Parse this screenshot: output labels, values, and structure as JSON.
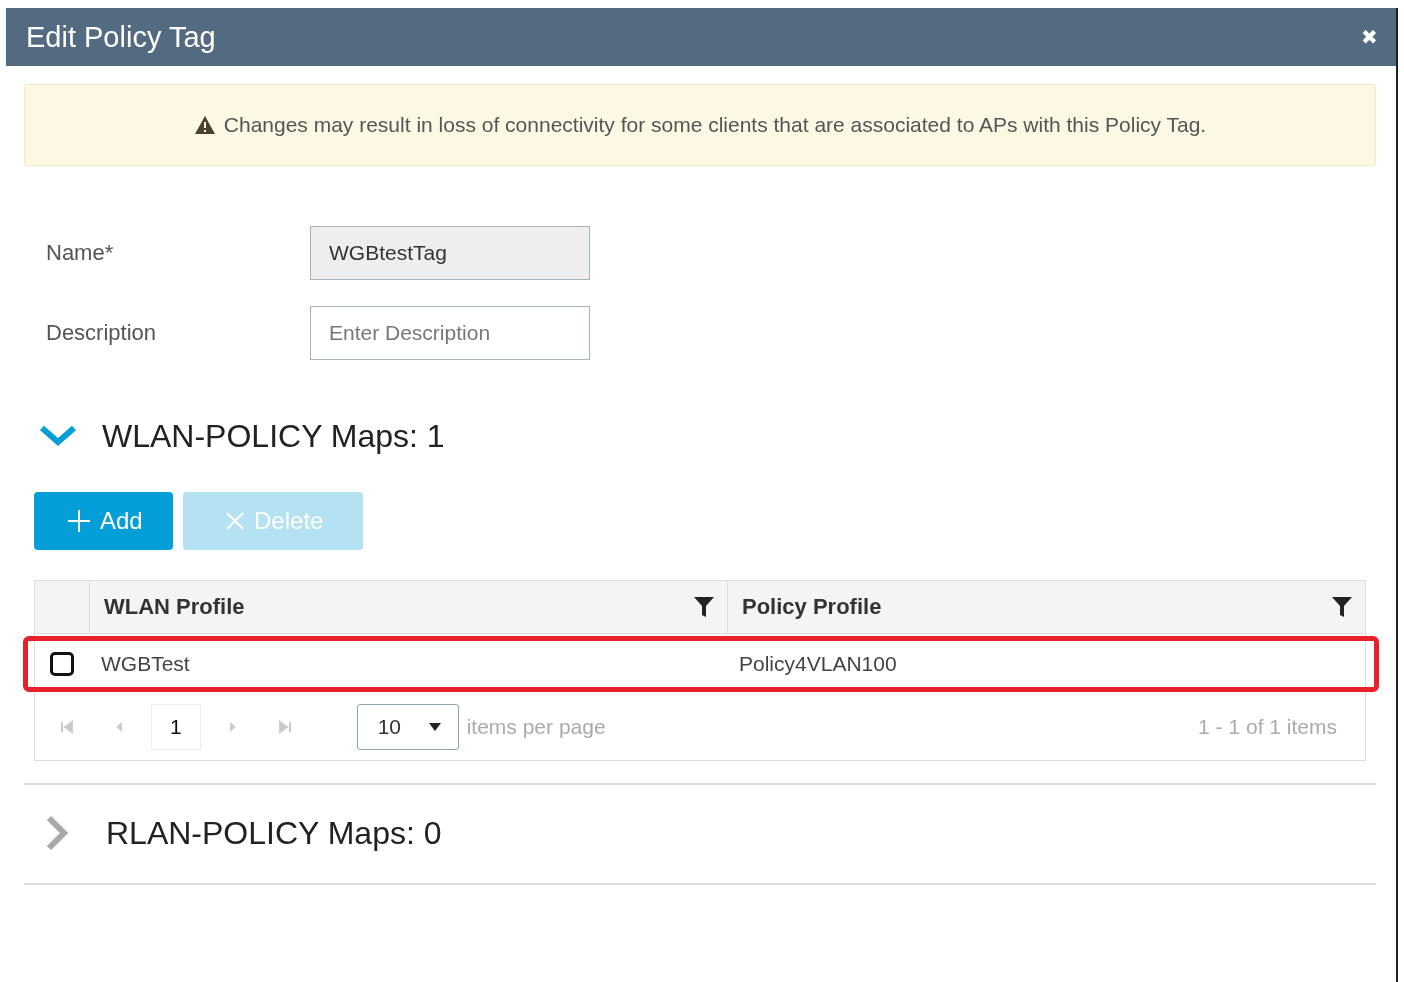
{
  "dialog": {
    "title": "Edit Policy Tag",
    "close": "✖"
  },
  "warning": {
    "text": "Changes may result in loss of connectivity for some clients that are associated to APs with this Policy Tag."
  },
  "fields": [
    {
      "label": "Name*",
      "value": "WGBtestTag",
      "disabled": true
    },
    {
      "label": "Description",
      "placeholder": "Enter Description",
      "disabled": false
    }
  ],
  "sections": [
    {
      "title": "WLAN-POLICY Maps: 1",
      "expanded": true,
      "buttons": [
        {
          "label": "Add",
          "kind": "add",
          "disabled": false
        },
        {
          "label": "Delete",
          "kind": "delete",
          "disabled": true
        }
      ],
      "table": {
        "columns": [
          "WLAN Profile",
          "Policy Profile"
        ],
        "rows": [
          {
            "checked": false,
            "highlighted": true,
            "cells": [
              "WGBTest",
              "Policy4VLAN100"
            ]
          }
        ],
        "pager": {
          "page": "1",
          "page_size": "10",
          "page_size_label": "items per page",
          "summary": "1 - 1 of 1 items"
        }
      }
    },
    {
      "title": "RLAN-POLICY Maps: 0",
      "expanded": false
    }
  ]
}
